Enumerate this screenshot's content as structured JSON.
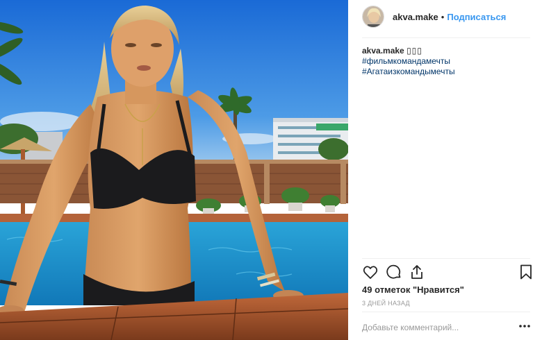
{
  "header": {
    "username": "akva.make",
    "separator": "•",
    "follow_label": "Подписаться"
  },
  "caption": {
    "username": "akva.make",
    "emoji": "▯▯▯",
    "hashtags": [
      "#фильмкомандамечты",
      "#Агатаизкомандымечты"
    ]
  },
  "actions": {
    "icons": [
      "heart-icon",
      "comment-icon",
      "share-icon",
      "bookmark-icon"
    ]
  },
  "likes": "49 отметок \"Нравится\"",
  "timestamp": "3 ДНЕЙ НАЗАД",
  "comment": {
    "placeholder": "Добавьте комментарий..."
  },
  "colors": {
    "link": "#3897f0",
    "hashtag": "#003569",
    "muted": "#999999",
    "divider": "#efefef"
  }
}
